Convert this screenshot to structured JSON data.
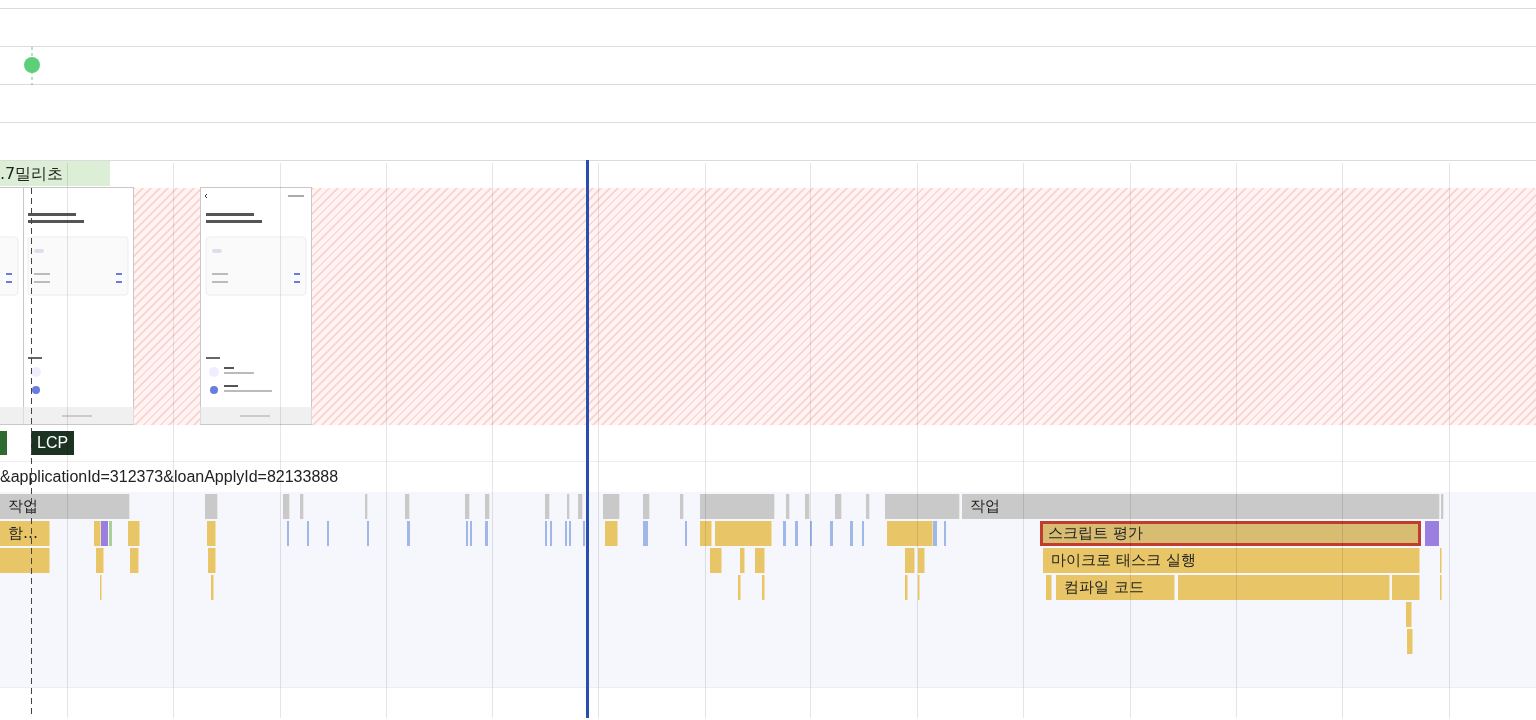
{
  "timing": {
    "label": ".7밀리초"
  },
  "markers": [
    {
      "kind": "event"
    },
    {
      "kind": "lcp",
      "label": "LCP"
    }
  ],
  "network": {
    "url": "&applicationId=312373&loanApplyId=82133888"
  },
  "flame_chart": {
    "entries": [
      {
        "label": "작업",
        "kind": "task",
        "selected": false
      },
      {
        "label": "함…",
        "kind": "script",
        "selected": false
      },
      {
        "label": "작업",
        "kind": "task",
        "selected": false
      },
      {
        "label": "스크립트 평가",
        "kind": "script",
        "selected": true
      },
      {
        "label": "마이크로 태스크 실행",
        "kind": "script",
        "selected": false
      },
      {
        "label": "컴파일 코드",
        "kind": "script",
        "selected": false
      }
    ]
  }
}
